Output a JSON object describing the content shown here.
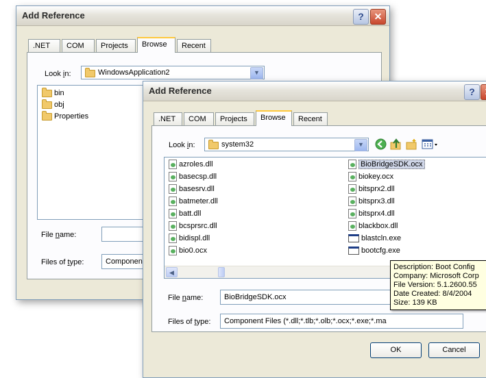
{
  "back_dialog": {
    "title": "Add Reference",
    "tabs": [
      ".NET",
      "COM",
      "Projects",
      "Browse",
      "Recent"
    ],
    "look_in_label": "Look in:",
    "look_in_value": "WindowsApplication2",
    "items": [
      "bin",
      "obj",
      "Properties"
    ],
    "file_name_label": "File name:",
    "files_of_type_label": "Files of type:",
    "files_of_type_value": "Component Files"
  },
  "front_dialog": {
    "title": "Add Reference",
    "tabs": [
      ".NET",
      "COM",
      "Projects",
      "Browse",
      "Recent"
    ],
    "look_in_label": "Look in:",
    "look_in_value": "system32",
    "files_col1": [
      "azroles.dll",
      "basecsp.dll",
      "basesrv.dll",
      "batmeter.dll",
      "batt.dll",
      "bcsprsrc.dll",
      "bidispl.dll",
      "bio0.ocx"
    ],
    "files_col2": [
      "BioBridgeSDK.ocx",
      "biokey.ocx",
      "bitsprx2.dll",
      "bitsprx3.dll",
      "bitsprx4.dll",
      "blackbox.dll",
      "blastcln.exe",
      "bootcfg.exe"
    ],
    "selected_file": "BioBridgeSDK.ocx",
    "file_name_label": "File name:",
    "file_name_value": "BioBridgeSDK.ocx",
    "files_of_type_label": "Files of type:",
    "files_of_type_value": "Component Files (*.dll;*.tlb;*.olb;*.ocx;*.exe;*.ma",
    "ok_label": "OK",
    "cancel_label": "Cancel"
  },
  "tooltip": {
    "lines": [
      "Description: Boot Config",
      "Company: Microsoft Corp",
      "File Version: 5.1.2600.55",
      "Date Created: 8/4/2004",
      "Size: 139 KB"
    ]
  }
}
